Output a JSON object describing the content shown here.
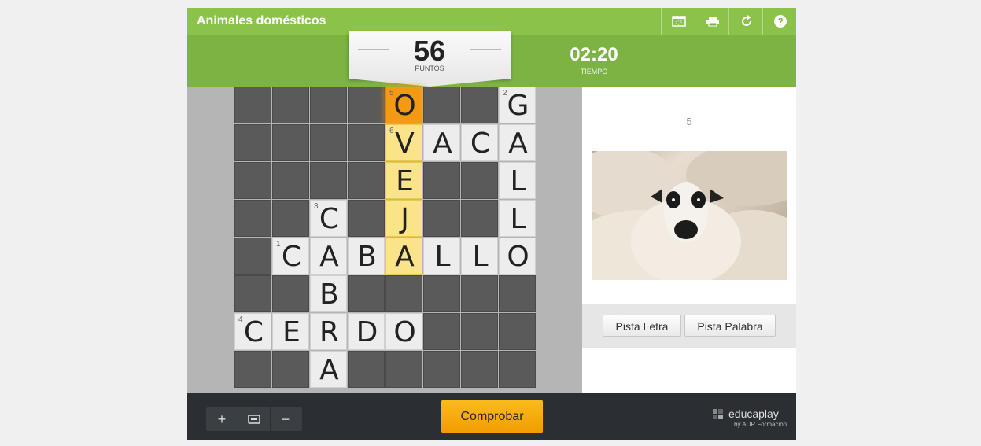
{
  "app": {
    "title": "Animales domésticos"
  },
  "toolbar": {
    "icons": [
      "fullscreen-icon",
      "print-icon",
      "restart-icon",
      "help-icon"
    ]
  },
  "score": {
    "value": "56",
    "label": "PUNTOS"
  },
  "timer": {
    "value": "02:20",
    "label": "TIEMPO"
  },
  "grid": {
    "rows": 8,
    "cols": 8,
    "cells": [
      [
        "",
        "",
        "",
        "",
        "O",
        "",
        "",
        "G"
      ],
      [
        "",
        "",
        "",
        "",
        "V",
        "A",
        "C",
        "A"
      ],
      [
        "",
        "",
        "",
        "",
        "E",
        "",
        "",
        "L"
      ],
      [
        "",
        "",
        "C",
        "",
        "J",
        "",
        "",
        "L"
      ],
      [
        "",
        "C",
        "A",
        "B",
        "A",
        "L",
        "L",
        "O"
      ],
      [
        "",
        "",
        "B",
        "",
        "",
        "",
        "",
        ""
      ],
      [
        "C",
        "E",
        "R",
        "D",
        "O",
        "",
        "",
        ""
      ],
      [
        "",
        "",
        "A",
        "",
        "",
        "",
        "",
        ""
      ]
    ],
    "numbers": [
      {
        "row": 0,
        "col": 4,
        "n": "5"
      },
      {
        "row": 0,
        "col": 7,
        "n": "2"
      },
      {
        "row": 1,
        "col": 4,
        "n": "6"
      },
      {
        "row": 3,
        "col": 2,
        "n": "3"
      },
      {
        "row": 4,
        "col": 1,
        "n": "1"
      },
      {
        "row": 6,
        "col": 0,
        "n": "4"
      }
    ],
    "highlight_word": [
      [
        1,
        4
      ],
      [
        2,
        4
      ],
      [
        3,
        4
      ],
      [
        4,
        4
      ]
    ],
    "active_cell": [
      0,
      4
    ]
  },
  "clue": {
    "number": "5",
    "image": "sheep-photo"
  },
  "hints": {
    "letter_label": "Pista Letra",
    "word_label": "Pista Palabra"
  },
  "footer": {
    "zoom_in": "+",
    "zoom_fit": "fit-icon",
    "zoom_out": "−",
    "check_label": "Comprobar",
    "brand_name": "educaplay",
    "brand_sub": "by ADR Formación"
  },
  "colors": {
    "header_green": "#8bc34a",
    "score_green": "#7cb342",
    "cell_yellow": "#fbe38a",
    "cell_orange": "#f39a12",
    "button_orange": "#f29c00"
  }
}
